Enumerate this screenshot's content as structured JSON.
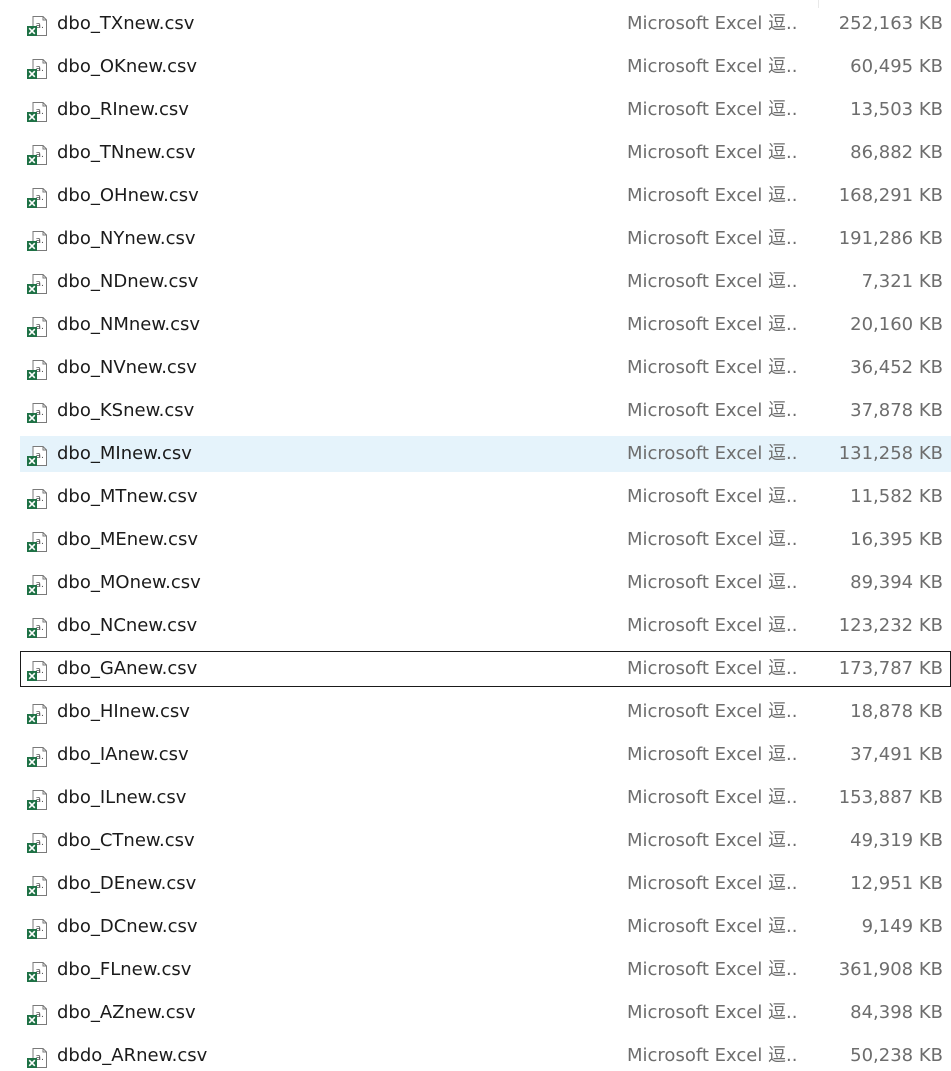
{
  "colors": {
    "selected_row": "#e5f3fb",
    "focus_border": "#1a1a1a",
    "excel_green": "#1e7145",
    "name_text": "#1b1b1b",
    "meta_text": "#6d6d6d"
  },
  "selected_index": 10,
  "focused_index": 15,
  "files": [
    {
      "name": "dbo_TXnew.csv",
      "type": "Microsoft Excel 逗...",
      "size": "252,163 KB",
      "icon": "excel-csv-icon"
    },
    {
      "name": "dbo_OKnew.csv",
      "type": "Microsoft Excel 逗...",
      "size": "60,495 KB",
      "icon": "excel-csv-icon"
    },
    {
      "name": "dbo_RInew.csv",
      "type": "Microsoft Excel 逗...",
      "size": "13,503 KB",
      "icon": "excel-csv-icon"
    },
    {
      "name": "dbo_TNnew.csv",
      "type": "Microsoft Excel 逗...",
      "size": "86,882 KB",
      "icon": "excel-csv-icon"
    },
    {
      "name": "dbo_OHnew.csv",
      "type": "Microsoft Excel 逗...",
      "size": "168,291 KB",
      "icon": "excel-csv-icon"
    },
    {
      "name": "dbo_NYnew.csv",
      "type": "Microsoft Excel 逗...",
      "size": "191,286 KB",
      "icon": "excel-csv-icon"
    },
    {
      "name": "dbo_NDnew.csv",
      "type": "Microsoft Excel 逗...",
      "size": "7,321 KB",
      "icon": "excel-csv-icon"
    },
    {
      "name": "dbo_NMnew.csv",
      "type": "Microsoft Excel 逗...",
      "size": "20,160 KB",
      "icon": "excel-csv-icon"
    },
    {
      "name": "dbo_NVnew.csv",
      "type": "Microsoft Excel 逗...",
      "size": "36,452 KB",
      "icon": "excel-csv-icon"
    },
    {
      "name": "dbo_KSnew.csv",
      "type": "Microsoft Excel 逗...",
      "size": "37,878 KB",
      "icon": "excel-csv-icon"
    },
    {
      "name": "dbo_MInew.csv",
      "type": "Microsoft Excel 逗...",
      "size": "131,258 KB",
      "icon": "excel-csv-icon"
    },
    {
      "name": "dbo_MTnew.csv",
      "type": "Microsoft Excel 逗...",
      "size": "11,582 KB",
      "icon": "excel-csv-icon"
    },
    {
      "name": "dbo_MEnew.csv",
      "type": "Microsoft Excel 逗...",
      "size": "16,395 KB",
      "icon": "excel-csv-icon"
    },
    {
      "name": "dbo_MOnew.csv",
      "type": "Microsoft Excel 逗...",
      "size": "89,394 KB",
      "icon": "excel-csv-icon"
    },
    {
      "name": "dbo_NCnew.csv",
      "type": "Microsoft Excel 逗...",
      "size": "123,232 KB",
      "icon": "excel-csv-icon"
    },
    {
      "name": "dbo_GAnew.csv",
      "type": "Microsoft Excel 逗...",
      "size": "173,787 KB",
      "icon": "excel-csv-icon"
    },
    {
      "name": "dbo_HInew.csv",
      "type": "Microsoft Excel 逗...",
      "size": "18,878 KB",
      "icon": "excel-csv-icon"
    },
    {
      "name": "dbo_IAnew.csv",
      "type": "Microsoft Excel 逗...",
      "size": "37,491 KB",
      "icon": "excel-csv-icon"
    },
    {
      "name": "dbo_ILnew.csv",
      "type": "Microsoft Excel 逗...",
      "size": "153,887 KB",
      "icon": "excel-csv-icon"
    },
    {
      "name": "dbo_CTnew.csv",
      "type": "Microsoft Excel 逗...",
      "size": "49,319 KB",
      "icon": "excel-csv-icon"
    },
    {
      "name": "dbo_DEnew.csv",
      "type": "Microsoft Excel 逗...",
      "size": "12,951 KB",
      "icon": "excel-csv-icon"
    },
    {
      "name": "dbo_DCnew.csv",
      "type": "Microsoft Excel 逗...",
      "size": "9,149 KB",
      "icon": "excel-csv-icon"
    },
    {
      "name": "dbo_FLnew.csv",
      "type": "Microsoft Excel 逗...",
      "size": "361,908 KB",
      "icon": "excel-csv-icon"
    },
    {
      "name": "dbo_AZnew.csv",
      "type": "Microsoft Excel 逗...",
      "size": "84,398 KB",
      "icon": "excel-csv-icon"
    },
    {
      "name": "dbdo_ARnew.csv",
      "type": "Microsoft Excel 逗...",
      "size": "50,238 KB",
      "icon": "excel-csv-icon"
    }
  ]
}
